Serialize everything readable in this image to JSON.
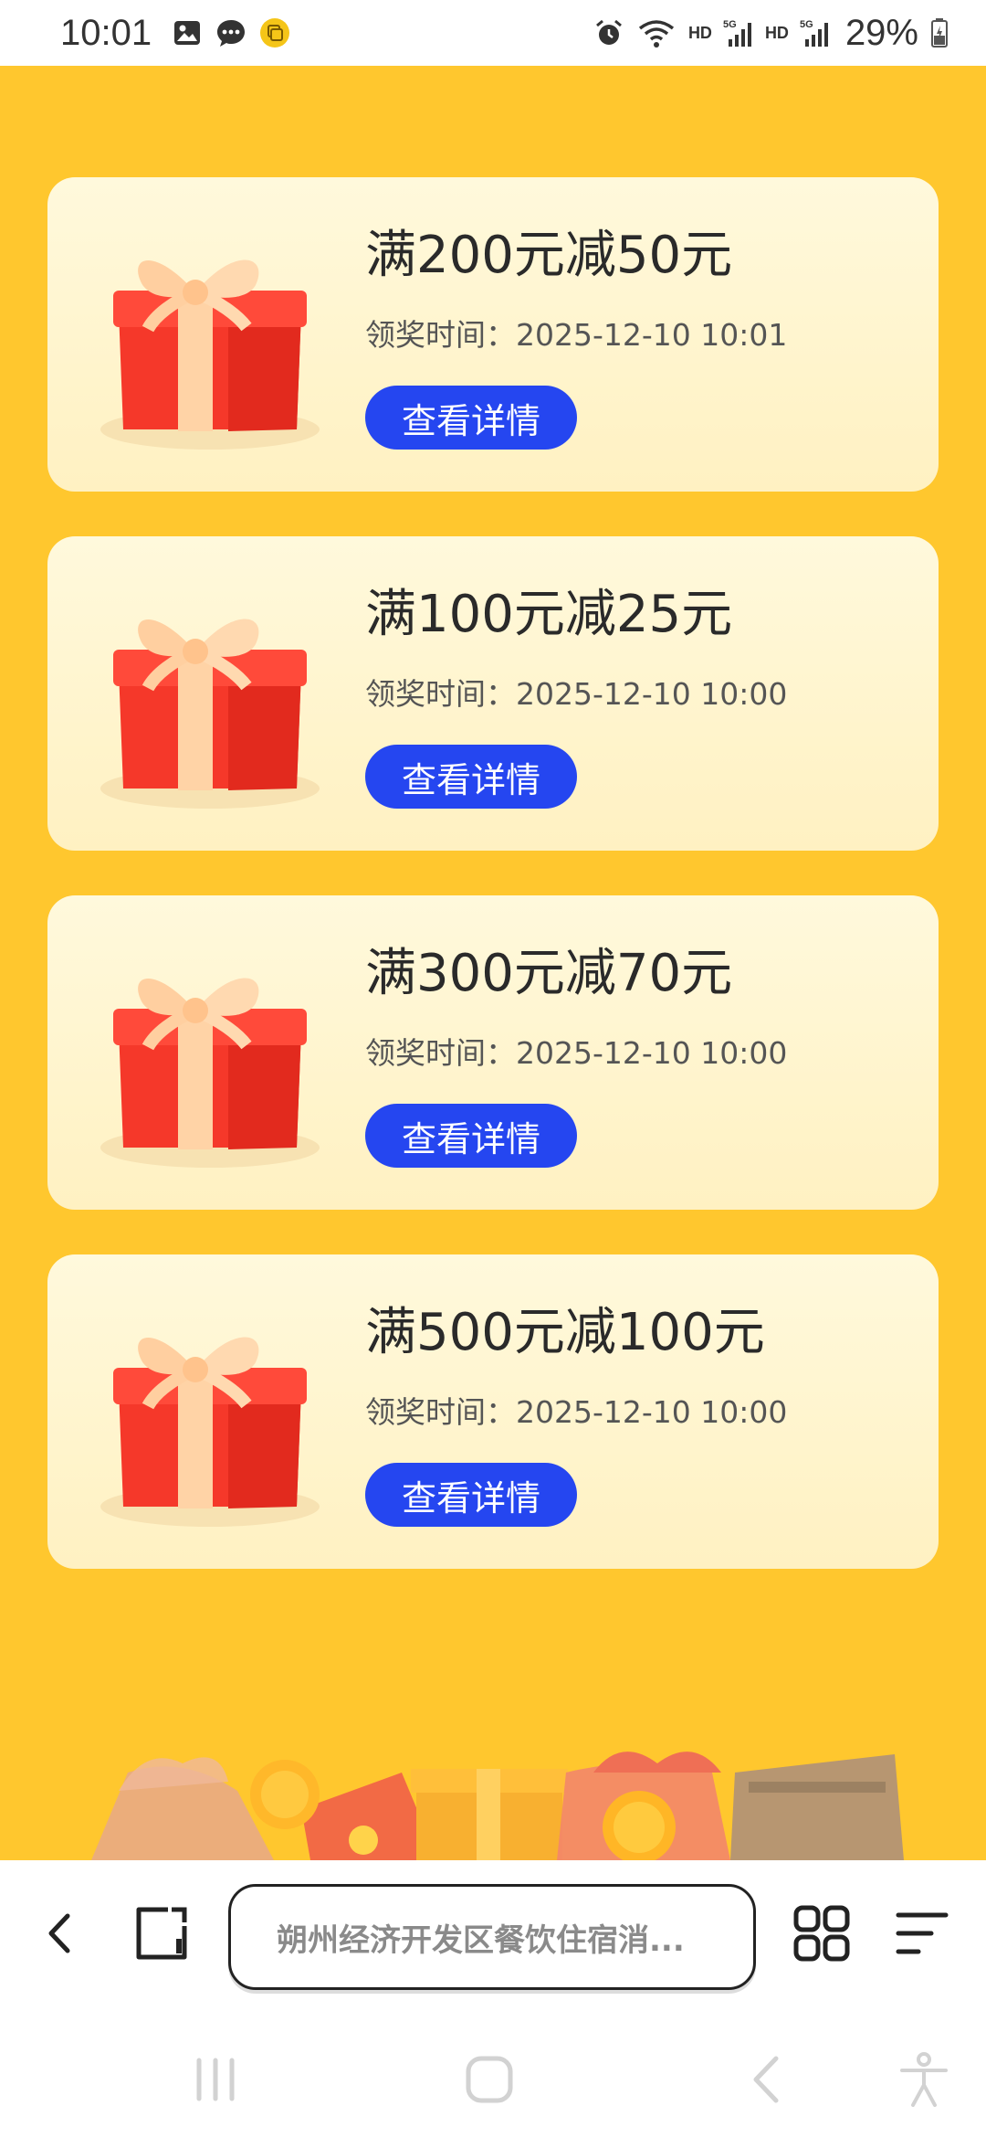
{
  "status_bar": {
    "time": "10:01",
    "left_icons": [
      "image-icon",
      "message-icon",
      "app-badge-icon"
    ],
    "right_icons": [
      "alarm-icon",
      "wifi-icon",
      "signal-icon",
      "signal-icon-2",
      "battery-icon"
    ],
    "hd1": "HD",
    "hd2": "HD",
    "battery": "29%"
  },
  "cards": [
    {
      "title": "满200元减50元",
      "time_label": "领奖时间：",
      "time_value": "2025-12-10 10:01",
      "button": "查看详情"
    },
    {
      "title": "满100元减25元",
      "time_label": "领奖时间：",
      "time_value": "2025-12-10 10:00",
      "button": "查看详情"
    },
    {
      "title": "满300元减70元",
      "time_label": "领奖时间：",
      "time_value": "2025-12-10 10:00",
      "button": "查看详情"
    },
    {
      "title": "满500元减100元",
      "time_label": "领奖时间：",
      "time_value": "2025-12-10 10:00",
      "button": "查看详情"
    }
  ],
  "browser": {
    "address": "朔州经济开发区餐饮住宿消...",
    "icons": [
      "back-icon",
      "tab-icon",
      "apps-icon",
      "menu-icon"
    ]
  },
  "system_nav": {
    "icons": [
      "recents-icon",
      "home-icon",
      "back-icon",
      "accessibility-icon"
    ]
  },
  "colors": {
    "background": "#ffc72e",
    "button": "#2546f0",
    "card": "#fff6d4",
    "gift_red": "#f43a2b"
  }
}
